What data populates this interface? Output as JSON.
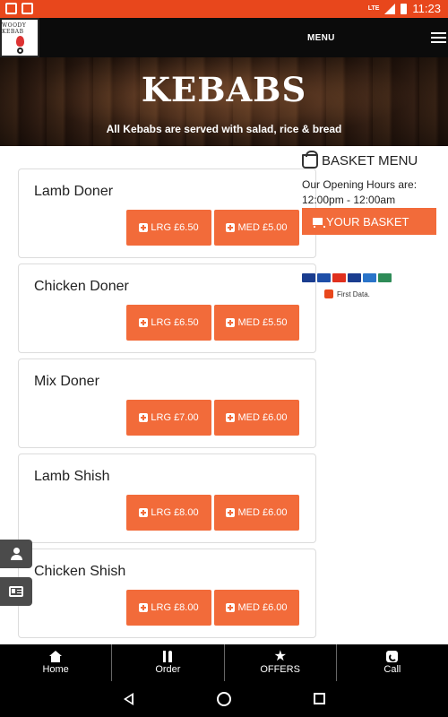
{
  "status_bar": {
    "time": "11:23",
    "network": "LTE",
    "left_icons": [
      "notification-icon",
      "android-icon"
    ]
  },
  "header": {
    "logo_text": "WOODY KEBAB",
    "menu_label": "MENU"
  },
  "hero": {
    "title": "KEBABS",
    "subtitle": "All Kebabs are served with salad, rice & bread"
  },
  "menu_items": [
    {
      "name": "Lamb Doner",
      "lrg": "LRG £6.50",
      "med": "MED £5.00"
    },
    {
      "name": "Chicken Doner",
      "lrg": "LRG £6.50",
      "med": "MED £5.50"
    },
    {
      "name": "Mix Doner",
      "lrg": "LRG £7.00",
      "med": "MED £6.00"
    },
    {
      "name": "Lamb Shish",
      "lrg": "LRG £8.00",
      "med": "MED £6.00"
    },
    {
      "name": "Chicken Shish",
      "lrg": "LRG £8.00",
      "med": "MED £6.00"
    }
  ],
  "basket": {
    "title": "BASKET MENU",
    "hours_title": "Our Opening Hours are:",
    "hours_value": "12:00pm - 12:00am",
    "your_basket": "YOUR BASKET"
  },
  "payments": {
    "cards": [
      "visa",
      "visa",
      "mastercard",
      "visa",
      "maestro",
      "jcb"
    ],
    "first_data": "First Data."
  },
  "bottom_nav": {
    "items": [
      {
        "label": "Home",
        "icon": "home-icon"
      },
      {
        "label": "Order",
        "icon": "cutlery-icon"
      },
      {
        "label": "OFFERS",
        "icon": "star-icon"
      },
      {
        "label": "Call",
        "icon": "phone-icon"
      }
    ]
  },
  "colors": {
    "status_bar": "#e8471c",
    "accent": "#f26b3a",
    "header_bg": "#0b0b0b",
    "nav_bg": "#000000",
    "side_button_bg": "#4b4b4b"
  }
}
